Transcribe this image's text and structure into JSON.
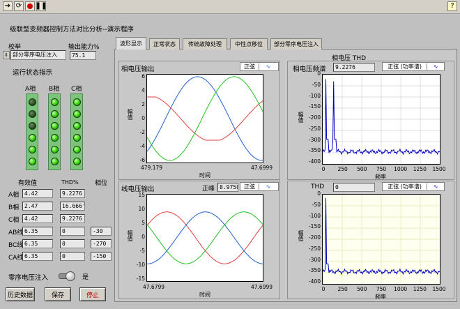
{
  "toolbar": {
    "icons": [
      "run-arrow-icon",
      "run-continuous-icon",
      "abort-icon",
      "pause-icon"
    ],
    "help": "?"
  },
  "title": "级联型变频器控制方法对比分析--演示程序",
  "left": {
    "mode_label": "校举",
    "mode_value": "部分零序电压注入",
    "capacity_label": "输出能力%",
    "capacity_value": "75.1",
    "status_title": "运行状态指示",
    "phase_labels": [
      "A相",
      "B相",
      "C相"
    ],
    "leds": {
      "A": [
        0,
        0,
        0,
        1,
        1,
        1
      ],
      "B": [
        1,
        1,
        1,
        1,
        1,
        1
      ],
      "C": [
        1,
        1,
        1,
        1,
        1,
        1
      ]
    },
    "rms_header": "有效值",
    "thd_header": "THD%",
    "phase_header": "相位",
    "rows": [
      {
        "label": "A相",
        "rms": "4.42",
        "thd": "9.2276",
        "phase": ""
      },
      {
        "label": "B相",
        "rms": "2.47",
        "thd": "16.666'",
        "phase": ""
      },
      {
        "label": "C相",
        "rms": "4.42",
        "thd": "9.2276",
        "phase": ""
      },
      {
        "label": "AB线",
        "rms": "6.35",
        "thd": "0",
        "phase": "-30"
      },
      {
        "label": "BC线",
        "rms": "6.35",
        "thd": "0",
        "phase": "-270"
      },
      {
        "label": "CA线",
        "rms": "6.35",
        "thd": "0",
        "phase": "-150"
      }
    ],
    "zero_seq_label": "零序电压注入",
    "zero_seq_state": "是",
    "buttons": {
      "history": "历史数据",
      "save": "保存",
      "stop": "停止"
    }
  },
  "tabs": [
    "波形显示",
    "正常状态",
    "传统故障处理",
    "中性点移位",
    "部分零序电压注入"
  ],
  "charts": {
    "phase_voltage": {
      "title": "相电压输出",
      "legend": "正弦",
      "xlabel": "时间",
      "ylabel": "幅值",
      "xstart": "479.179",
      "xend": "47.6999",
      "yticks": [
        "6",
        "4",
        "2",
        "0",
        "-2",
        "-4",
        "-6"
      ]
    },
    "line_voltage": {
      "title": "线电压输出",
      "legend": "正弦",
      "peak_label": "正峰",
      "peak_value": "8.9750",
      "xlabel": "时间",
      "ylabel": "幅值",
      "xstart": "47.6799",
      "xend": "47.6999",
      "yticks": [
        "15",
        "10",
        "5",
        "0",
        "-5",
        "-10",
        "-15"
      ]
    },
    "phase_spectrum": {
      "header_top": "相电压 THD",
      "title": "相电压频谱",
      "thd_value": "9.2276",
      "legend": "正弦 (功率谱)",
      "xlabel": "频率",
      "ylabel": "幅值",
      "xticks": [
        "0",
        "250",
        "500",
        "750",
        "1000",
        "1250",
        "1500"
      ],
      "yticks": [
        "0",
        "-50",
        "-100",
        "-150",
        "-200",
        "-250",
        "-300",
        "-350",
        "-400"
      ]
    },
    "line_spectrum": {
      "thd_label": "THD",
      "thd_value": "0",
      "legend": "正弦 (功率谱)",
      "xlabel": "频率",
      "ylabel": "幅值",
      "xticks": [
        "0",
        "250",
        "500",
        "750",
        "1000",
        "1250",
        "1500"
      ],
      "yticks": [
        "0",
        "-50",
        "-100",
        "-150",
        "-200",
        "-250",
        "-300",
        "-350",
        "-400"
      ]
    }
  },
  "colors": {
    "phaseA": "#2060d0",
    "phaseB": "#e04040",
    "phaseC": "#20c020",
    "spectrum": "#0000c0",
    "panel": "#c0c0c0"
  }
}
